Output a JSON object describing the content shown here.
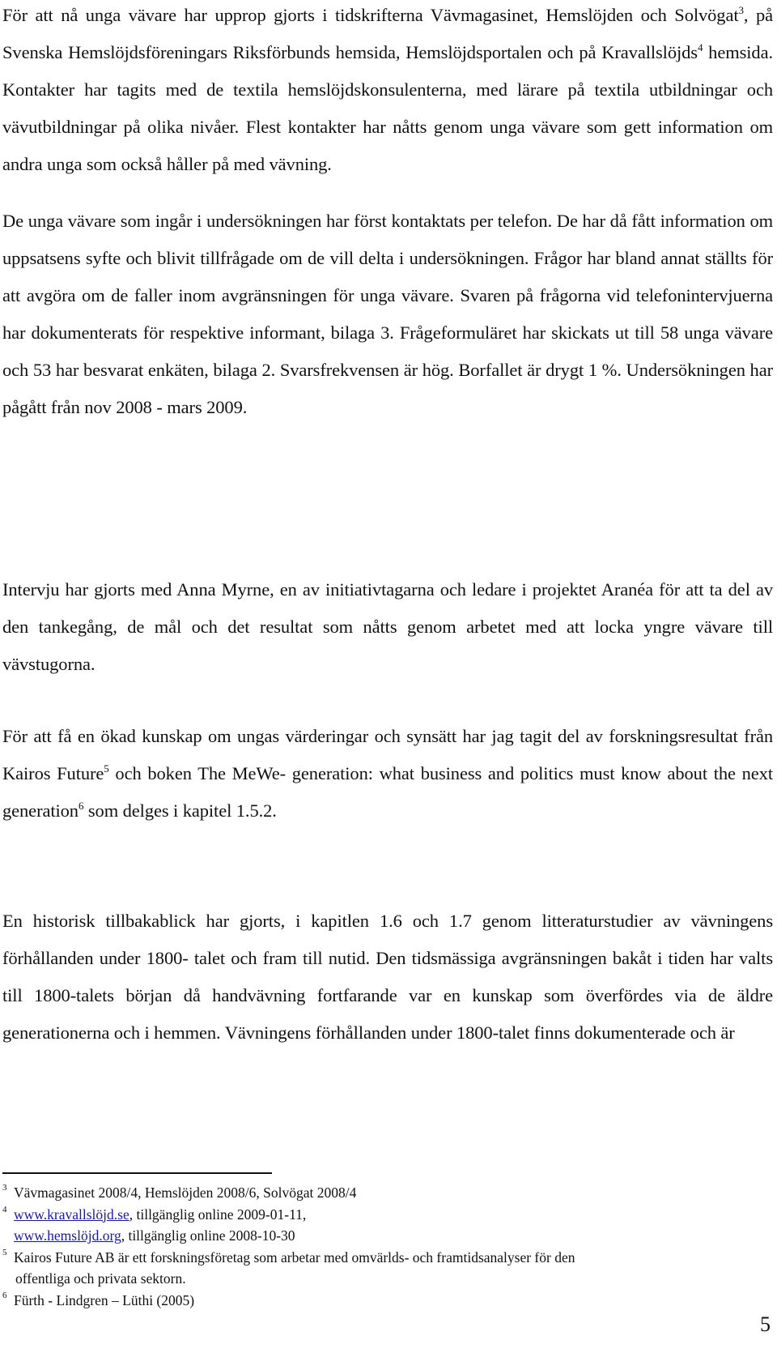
{
  "paragraphs": {
    "p1": {
      "a": "För att nå unga vävare har upprop gjorts i tidskrifterna Vävmagasinet, Hemslöjden och Solvögat",
      "sup1": "3",
      "b": ", på Svenska Hemslöjdsföreningars Riksförbunds hemsida, Hemslöjdsportalen och på Kravallslöjds",
      "sup2": "4",
      "c": " hemsida. Kontakter har tagits med de textila hemslöjdskonsulenterna, med lärare på textila utbildningar och vävutbildningar på olika nivåer. Flest kontakter har nåtts genom unga vävare som gett information om andra unga som också håller på med vävning."
    },
    "p2": "De unga vävare som ingår i undersökningen har först kontaktats per telefon. De har då fått information om uppsatsens syfte och blivit tillfrågade om de vill delta i undersökningen. Frågor har bland annat ställts för att avgöra om de faller inom avgränsningen för unga vävare. Svaren på frågorna vid telefonintervjuerna har dokumenterats för respektive informant, bilaga 3. Frågeformuläret har skickats ut till 58 unga vävare och 53 har besvarat enkäten, bilaga 2. Svarsfrekvensen är hög. Borfallet är drygt 1 %. Undersökningen har pågått från nov 2008 - mars 2009.",
    "p3": "Intervju har gjorts med Anna Myrne, en av initiativtagarna och ledare i projektet Aranéa för att ta del av den tankegång, de mål och det resultat som nåtts genom arbetet med att locka yngre vävare till vävstugorna.",
    "p4": {
      "a": "För att få en ökad kunskap om ungas värderingar och synsätt har jag tagit del av forskningsresultat från Kairos Future",
      "sup1": "5",
      "b": " och boken The MeWe- generation: what business and politics must know about the next generation",
      "sup2": "6",
      "c": " som delges i kapitel 1.5.2."
    },
    "p5": "En historisk tillbakablick har gjorts, i kapitlen 1.6 och 1.7 genom litteraturstudier av vävningens förhållanden under 1800- talet och fram till nutid. Den tidsmässiga avgränsningen bakåt i tiden har valts till 1800-talets början då handvävning fortfarande var en kunskap som överfördes via de äldre generationerna och i hemmen. Vävningens förhållanden under 1800-talet finns dokumenterade och är"
  },
  "footnotes": [
    {
      "num": "3",
      "text": "Vävmagasinet 2008/4, Hemslöjden 2008/6, Solvögat 2008/4"
    },
    {
      "num": "4",
      "link1": "www.kravallslöjd.se",
      "text1": ", tillgänglig online 2009-01-11,",
      "link2": "www.hemslöjd.org",
      "text2": ", tillgänglig online 2008-10-30"
    },
    {
      "num": "5",
      "text": "Kairos Future AB är ett forskningsföretag som arbetar med omvärlds- och framtidsanalyser för den",
      "cont": "offentliga och privata sektorn."
    },
    {
      "num": "6",
      "text": "Fürth - Lindgren – Lüthi (2005)"
    }
  ],
  "page_number": "5",
  "colors": {
    "text": "#111111",
    "link": "#1a1aa6",
    "background": "#ffffff"
  }
}
